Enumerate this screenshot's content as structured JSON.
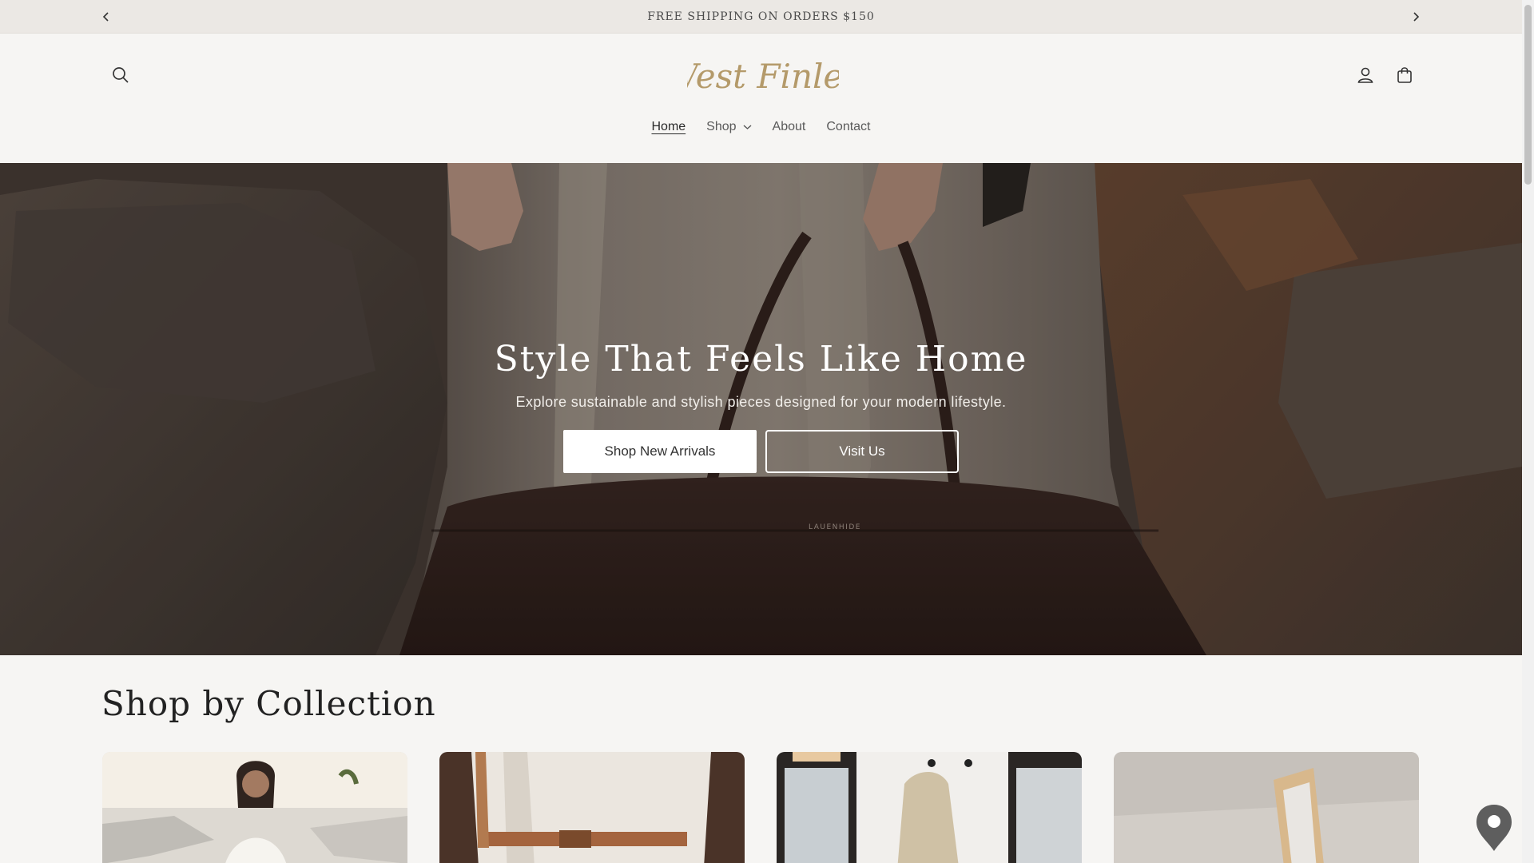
{
  "announcement": {
    "text": "FREE SHIPPING ON ORDERS $150"
  },
  "header": {
    "logo_text": "West Finley"
  },
  "nav": {
    "items": [
      {
        "label": "Home"
      },
      {
        "label": "Shop"
      },
      {
        "label": "About"
      },
      {
        "label": "Contact"
      }
    ]
  },
  "hero": {
    "title": "Style That Feels Like Home",
    "subtitle": "Explore sustainable and stylish pieces designed for your modern lifestyle.",
    "primary_button": "Shop New Arrivals",
    "secondary_button": "Visit Us",
    "bag_brand": "LAUENHIDE"
  },
  "collection": {
    "title": "Shop by Collection"
  },
  "colors": {
    "background": "#f6f5f3",
    "announcement_bg": "#ebe8e4",
    "logo": "#b49a6a",
    "text_dark": "#222222"
  },
  "icons": {
    "prev": "chevron-left-icon",
    "next": "chevron-right-icon",
    "search": "search-icon",
    "account": "user-icon",
    "cart": "shopping-bag-icon",
    "dropdown": "chevron-down-icon",
    "location": "map-pin-icon"
  }
}
